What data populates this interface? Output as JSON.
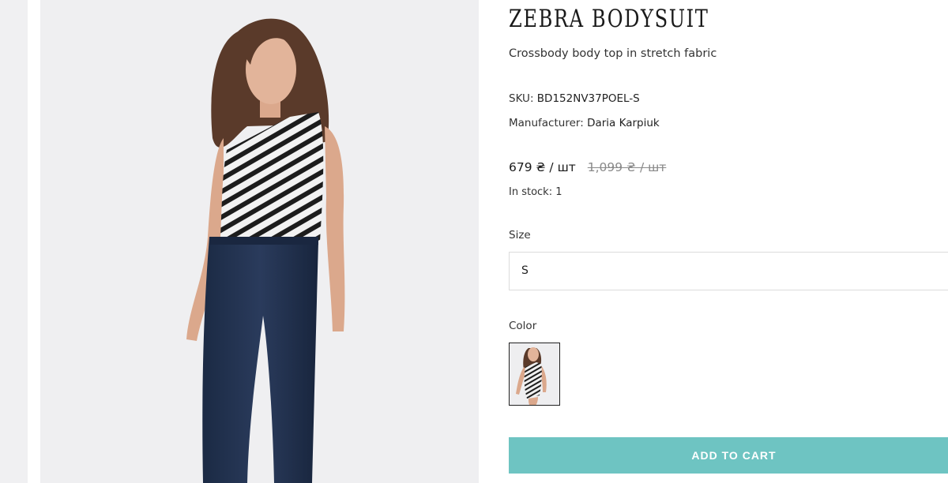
{
  "product": {
    "title": "ZEBRA BODYSUIT",
    "subtitle": "Crossbody body top in stretch fabric",
    "sku_label": "SKU:",
    "sku_value": "BD152NV37POEL-S",
    "manufacturer_label": "Manufacturer:",
    "manufacturer_value": "Daria Karpiuk",
    "price": "679 ₴ / шт",
    "old_price": "1,099 ₴ / шт",
    "stock": "In stock: 1"
  },
  "options": {
    "size_label": "Size",
    "size_value": "S",
    "color_label": "Color"
  },
  "cart": {
    "add_label": "ADD TO CART"
  },
  "colors": {
    "accent": "#6ec4c2",
    "background": "#ffffff",
    "photo_bg": "#efeff1"
  }
}
